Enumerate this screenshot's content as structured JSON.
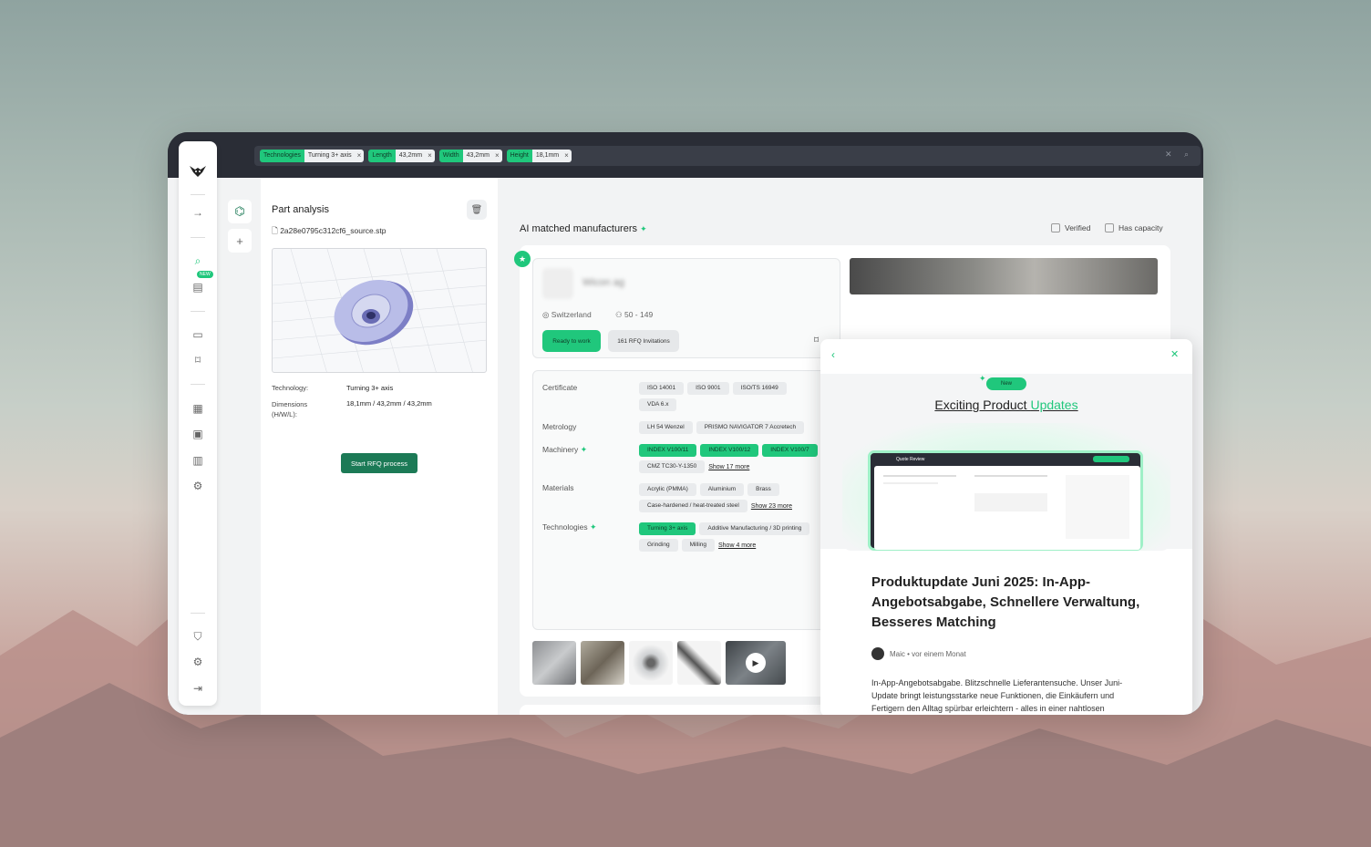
{
  "filters": [
    {
      "key": "Technologies",
      "value": "Turning 3+ axis"
    },
    {
      "key": "Length",
      "value": "43,2mm"
    },
    {
      "key": "Width",
      "value": "43,2mm"
    },
    {
      "key": "Height",
      "value": "18,1mm"
    }
  ],
  "sidebar": {
    "new_badge": "NEW"
  },
  "part_analysis": {
    "title": "Part analysis",
    "filename": "2a28e0795c312cf6_source.stp",
    "technology_label": "Technology:",
    "technology_value": "Turning 3+ axis",
    "dimensions_label": "Dimensions (H/W/L):",
    "dimensions_value": "18,1mm / 43,2mm / 43,2mm",
    "rfq_button": "Start RFQ process"
  },
  "main": {
    "title": "AI matched manufacturers",
    "verified_label": "Verified",
    "capacity_label": "Has capacity"
  },
  "manufacturer": {
    "name": "Wicon ag",
    "country": "Switzerland",
    "employees": "50 - 149",
    "status": "Ready to work",
    "invitations": "161 RFQ Invitations",
    "sections": [
      {
        "label": "Certificate",
        "tags": [
          "ISO 14001",
          "ISO 9001",
          "ISO/TS 16949",
          "VDA 6.x"
        ],
        "more": ""
      },
      {
        "label": "Metrology",
        "tags": [
          "LH 54 Wenzel",
          "PRISMO NAVIGATOR 7 Accretech"
        ],
        "more": ""
      },
      {
        "label": "Machinery",
        "tags": [
          "INDEX V100/11",
          "INDEX V100/12",
          "INDEX V100/7",
          "CMZ TC30-Y-1350"
        ],
        "more": "Show 17 more"
      },
      {
        "label": "Materials",
        "tags": [
          "Acrylic (PMMA)",
          "Aluminium",
          "Brass",
          "Case-hardened / heat-treated steel"
        ],
        "more": "Show 23 more"
      },
      {
        "label": "Technologies",
        "tags": [
          "Turning 3+ axis",
          "Additive Manufacturing / 3D printing",
          "Grinding",
          "Milling"
        ],
        "more": "Show 4 more"
      }
    ]
  },
  "popup": {
    "new_label": "New",
    "heading_a": "Exciting Product ",
    "heading_b": "Updates",
    "mock_title": "Quote Review",
    "article_title": "Produktupdate Juni 2025: In-App-Angebotsabgabe, Schnellere Verwaltung, Besseres Matching",
    "author": "Maic • vor einem Monat",
    "body": "In-App-Angebotsabgabe. Blitzschnelle Lieferantensuche. Unser Juni-Update bringt leistungsstarke neue Funktionen, die Einkäufern und Fertigern den Alltag spürbar erleichtern - alles in einer nahtlosen"
  },
  "colors": {
    "accent": "#20c77c",
    "dark": "#2a2d36",
    "button": "#1c7a56"
  }
}
